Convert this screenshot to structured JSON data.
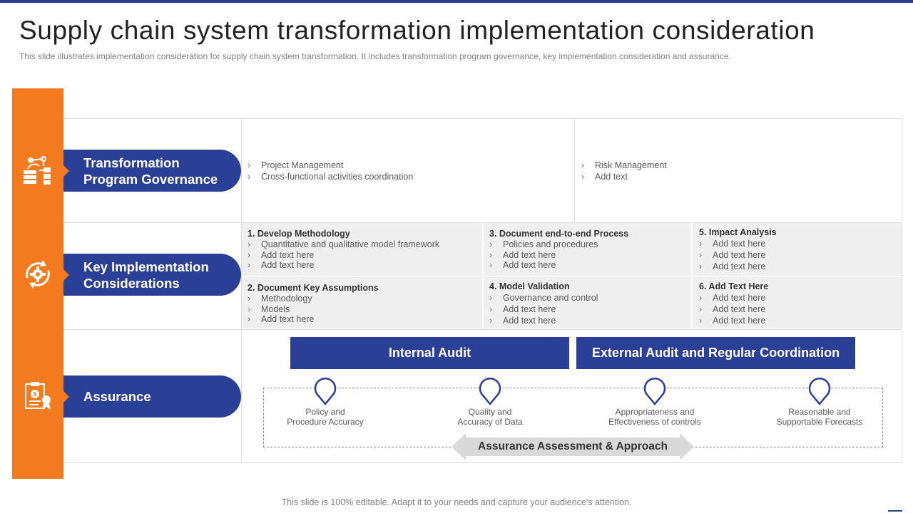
{
  "title": "Supply chain system transformation implementation consideration",
  "subtitle": "This slide illustrates implementation consideration for supply chain system transformation. It includes transformation program governance,  key implementation consideration and assurance.",
  "colors": {
    "accent_orange": "#f47a1f",
    "brand_blue": "#2a3f96",
    "grey_fill": "#efefef"
  },
  "rows": {
    "governance": {
      "label_line1": "Transformation",
      "label_line2": "Program Governance",
      "icon": "org-chart-icon",
      "col1": [
        "Project Management",
        "Cross-functional  activities coordination"
      ],
      "col2": [
        "Risk Management",
        "Add text"
      ]
    },
    "implementation": {
      "label_line1": "Key Implementation",
      "label_line2": "Considerations",
      "icon": "gear-cycle-icon",
      "cells": [
        {
          "head": "1. Develop Methodology",
          "items": [
            "Quantitative and qualitative model framework",
            "Add text here",
            "Add text here"
          ]
        },
        {
          "head": "3. Document end-to-end Process",
          "items": [
            "Policies and procedures",
            "Add text here",
            "Add text here"
          ]
        },
        {
          "head": "5. Impact Analysis",
          "items": [
            "Add text here",
            "Add text here",
            "Add text here"
          ]
        },
        {
          "head": "2. Document Key Assumptions",
          "items": [
            "Methodology",
            "Models",
            "Add text here"
          ]
        },
        {
          "head": "4. Model Validation",
          "items": [
            "Governance  and control",
            "Add text here",
            "Add text here"
          ]
        },
        {
          "head": "6. Add Text Here",
          "items": [
            "Add text here",
            "Add text here",
            "Add text here"
          ]
        }
      ]
    },
    "assurance": {
      "label": "Assurance",
      "icon": "audit-document-icon",
      "internal_audit": "Internal Audit",
      "external_audit": "External Audit and Regular Coordination",
      "points": [
        {
          "line1": "Policy and",
          "line2": "Procedure Accuracy"
        },
        {
          "line1": "Quality and",
          "line2": "Accuracy of Data"
        },
        {
          "line1": "Appropriateness and",
          "line2": "Effectiveness of controls"
        },
        {
          "line1": "Reasonable and",
          "line2": "Supportable Forecasts"
        }
      ],
      "approach_label": "Assurance Assessment & Approach"
    }
  },
  "footer": "This slide is 100% editable. Adapt it to your needs and capture your audience's attention."
}
